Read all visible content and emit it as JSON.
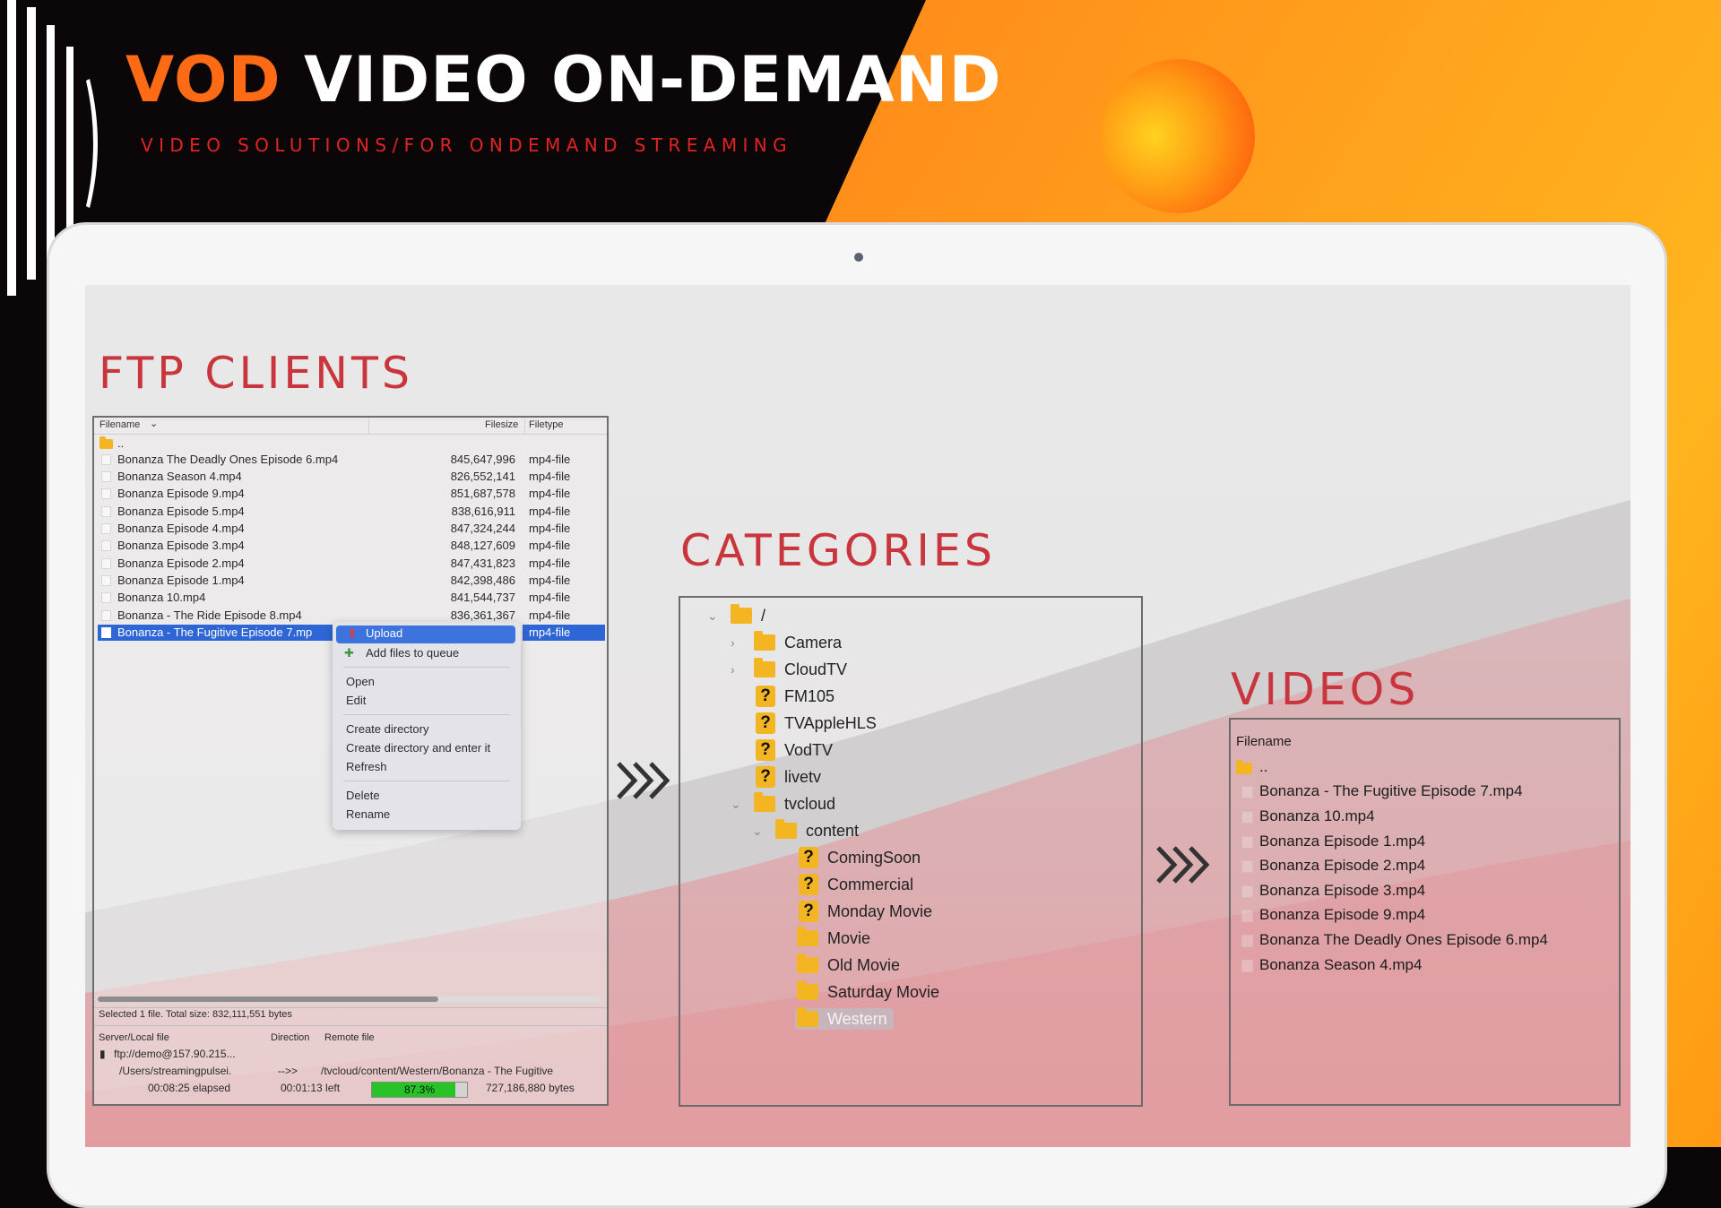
{
  "header": {
    "title_accent": "VOD",
    "title_rest": "VIDEO ON-DEMAND",
    "subtitle": "VIDEO SOLUTIONS/FOR ONDEMAND STREAMING"
  },
  "colors": {
    "accent_orange": "#ff6a14",
    "heading_red": "#c9353d",
    "selection_blue": "#2e66d6",
    "folder_yellow": "#f3b521"
  },
  "sections": {
    "ftp": "FTP CLIENTS",
    "categories": "CATEGORIES",
    "videos": "VIDEOS"
  },
  "ftp": {
    "columns": {
      "filename": "Filename",
      "filesize": "Filesize",
      "filetype": "Filetype"
    },
    "parent": "..",
    "files": [
      {
        "name": "Bonanza The Deadly Ones  Episode 6.mp4",
        "size": "845,647,996",
        "type": "mp4-file"
      },
      {
        "name": "Bonanza Season 4.mp4",
        "size": "826,552,141",
        "type": "mp4-file"
      },
      {
        "name": "Bonanza Episode 9.mp4",
        "size": "851,687,578",
        "type": "mp4-file"
      },
      {
        "name": "Bonanza Episode 5.mp4",
        "size": "838,616,911",
        "type": "mp4-file"
      },
      {
        "name": "Bonanza Episode 4.mp4",
        "size": "847,324,244",
        "type": "mp4-file"
      },
      {
        "name": "Bonanza Episode 3.mp4",
        "size": "848,127,609",
        "type": "mp4-file"
      },
      {
        "name": "Bonanza Episode 2.mp4",
        "size": "847,431,823",
        "type": "mp4-file"
      },
      {
        "name": "Bonanza Episode 1.mp4",
        "size": "842,398,486",
        "type": "mp4-file"
      },
      {
        "name": "Bonanza 10.mp4",
        "size": "841,544,737",
        "type": "mp4-file"
      },
      {
        "name": "Bonanza - The Ride  Episode 8.mp4",
        "size": "836,361,367",
        "type": "mp4-file"
      }
    ],
    "selected": {
      "name": "Bonanza - The Fugitive  Episode 7.mp",
      "type": "mp4-file"
    },
    "context_menu": {
      "upload": "Upload",
      "add_queue": "Add files to queue",
      "open": "Open",
      "edit": "Edit",
      "create_dir": "Create directory",
      "create_dir_enter": "Create directory and enter it",
      "refresh": "Refresh",
      "delete": "Delete",
      "rename": "Rename"
    },
    "status": "Selected 1 file. Total size: 832,111,551 bytes",
    "queue": {
      "col_server": "Server/Local file",
      "col_direction": "Direction",
      "col_remote": "Remote file",
      "server": "ftp://demo@157.90.215...",
      "local": "/Users/streamingpulsei.",
      "direction": "-->>",
      "remote": "/tvcloud/content/Western/Bonanza - The Fugitive",
      "elapsed": "00:08:25 elapsed",
      "left": "00:01:13 left",
      "progress_text": "87.3%",
      "progress": 0.873,
      "bytes": "727,186,880 bytes"
    }
  },
  "categories": {
    "root": "/",
    "camera": "Camera",
    "cloudtv": "CloudTV",
    "fm105": "FM105",
    "tvapplehls": "TVAppleHLS",
    "vodtv": "VodTV",
    "livetv": "livetv",
    "tvcloud": "tvcloud",
    "content": "content",
    "comingsoon": "ComingSoon",
    "commercial": "Commercial",
    "monday": "Monday Movie",
    "movie": "Movie",
    "oldmovie": "Old Movie",
    "saturday": "Saturday Movie",
    "western": "Western",
    "unknown_glyph": "?"
  },
  "videos": {
    "column": "Filename",
    "parent": "..",
    "items": [
      "Bonanza - The Fugitive  Episode 7.mp4",
      "Bonanza 10.mp4",
      "Bonanza Episode 1.mp4",
      "Bonanza Episode 2.mp4",
      "Bonanza Episode 3.mp4",
      "Bonanza Episode 9.mp4",
      "Bonanza The Deadly Ones  Episode 6.mp4",
      "Bonanza Season 4.mp4"
    ]
  }
}
